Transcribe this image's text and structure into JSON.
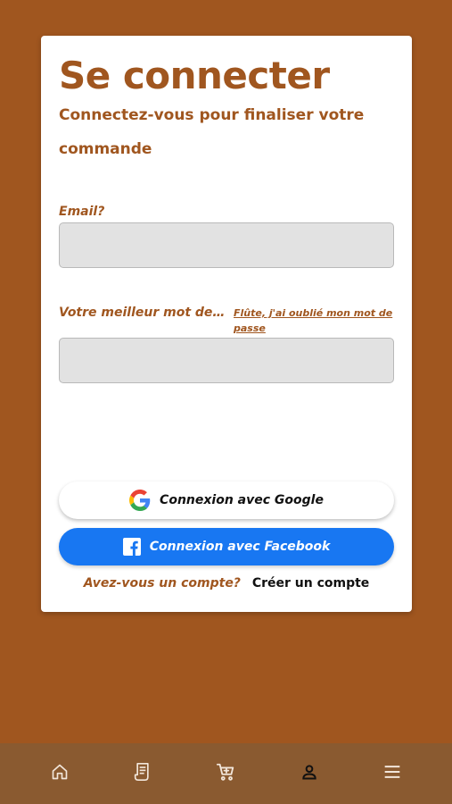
{
  "login": {
    "title": "Se connecter",
    "subtitle": "Connectez-vous pour finaliser votre commande",
    "email_label": "Email?",
    "email_value": "",
    "password_label": "Votre meilleur mot de p...",
    "password_value": "",
    "forgot_link": "Flûte, j'ai oublié mon mot de passe",
    "google_button": "Connexion avec Google",
    "facebook_button": "Connexion avec Facebook",
    "account_question": "Avez-vous un compte?",
    "create_account": "Créer un compte"
  },
  "navbar": {
    "items": [
      {
        "icon": "home-icon",
        "active": false
      },
      {
        "icon": "receipt-icon",
        "active": false
      },
      {
        "icon": "cart-icon",
        "active": false
      },
      {
        "icon": "person-icon",
        "active": true
      },
      {
        "icon": "menu-icon",
        "active": false
      }
    ]
  },
  "colors": {
    "background": "#a0561f",
    "accent_text": "#a0561f",
    "facebook": "#1877f2",
    "navbar": "#8a5a30"
  }
}
